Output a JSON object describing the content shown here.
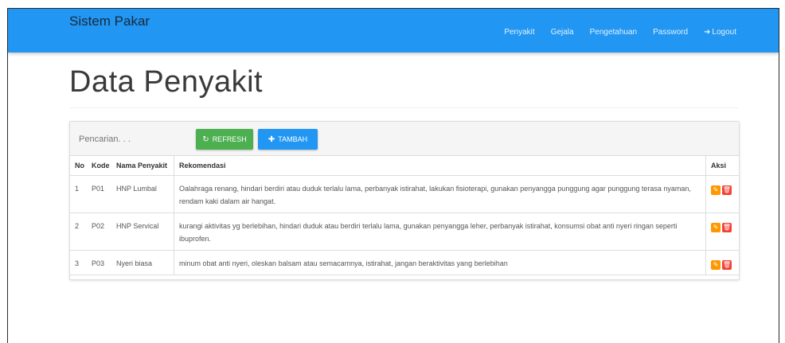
{
  "navbar": {
    "brand": "Sistem Pakar",
    "items": [
      {
        "label": "Penyakit"
      },
      {
        "label": "Gejala"
      },
      {
        "label": "Pengetahuan"
      },
      {
        "label": "Password"
      },
      {
        "label": "Logout",
        "icon": "logout-icon"
      }
    ]
  },
  "page": {
    "title": "Data Penyakit"
  },
  "toolbar": {
    "search_placeholder": "Pencarian. . .",
    "refresh_label": "REFRESH",
    "refresh_icon": "refresh-icon",
    "add_label": "TAMBAH",
    "add_icon": "plus-icon"
  },
  "table": {
    "headers": [
      "No",
      "Kode",
      "Nama Penyakit",
      "Rekomendasi",
      "Aksi"
    ],
    "rows": [
      {
        "no": "1",
        "kode": "P01",
        "nama": "HNP Lumbal",
        "rekomendasi": "Oalahraga renang, hindari berdiri atau duduk terlalu lama, perbanyak istirahat, lakukan fisioterapi, gunakan penyangga punggung agar punggung terasa nyaman, rendam kaki dalam air hangat."
      },
      {
        "no": "2",
        "kode": "P02",
        "nama": "HNP Servical",
        "rekomendasi": "kurangi aktivitas yg berlebihan, hindari duduk atau berdiri terlalu lama, gunakan penyangga leher, perbanyak istirahat, konsumsi obat anti nyeri ringan seperti ibuprofen."
      },
      {
        "no": "3",
        "kode": "P03",
        "nama": "Nyeri biasa",
        "rekomendasi": "minum obat anti nyeri, oleskan balsam atau semacamnya, istirahat, jangan beraktivitas yang berlebihan"
      }
    ],
    "edit_icon": "edit-icon",
    "delete_icon": "trash-icon"
  },
  "colors": {
    "navbar": "#2196f3",
    "refresh": "#4caf50",
    "add": "#2196f3",
    "edit": "#ff9800",
    "delete": "#f44336"
  }
}
